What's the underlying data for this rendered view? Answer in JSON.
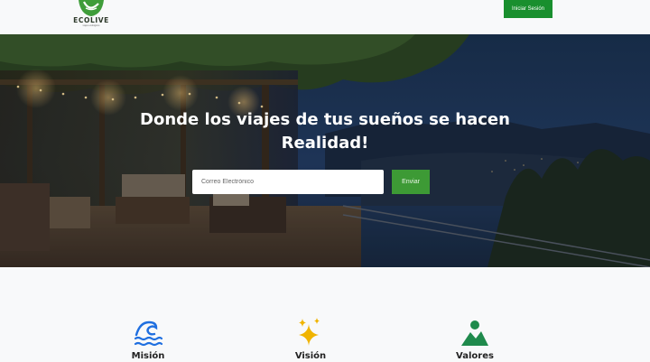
{
  "header": {
    "logo_text": "ECOLIVE",
    "logo_tagline": "viajes ecológicos",
    "login_label": "Iniciar Sesión"
  },
  "hero": {
    "title": "Donde los viajes de tus sueños se hacen Realidad!",
    "email_placeholder": "Correo Electrónico",
    "email_value": "",
    "send_label": "Enviar"
  },
  "features": [
    {
      "title": "Misión",
      "icon": "water-waves-icon",
      "color": "#1f6fe0"
    },
    {
      "title": "Visión",
      "icon": "sparkles-icon",
      "color": "#f0b400"
    },
    {
      "title": "Valores",
      "icon": "landscape-icon",
      "color": "#1f8a4c"
    }
  ],
  "colors": {
    "primary_green": "#198f2e",
    "send_green": "#3d9a35",
    "header_bg": "#f8f9fa"
  }
}
